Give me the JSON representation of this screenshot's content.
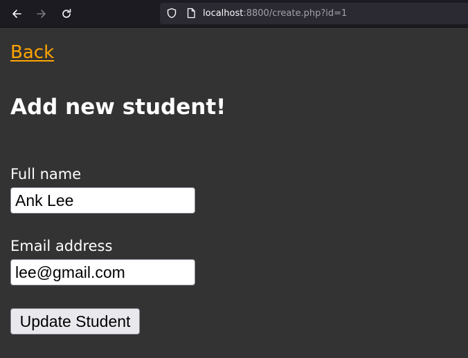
{
  "browser": {
    "url_host": "localhost",
    "url_rest": ":8800/create.php?id=1",
    "icons": {
      "back": "arrow-left-icon",
      "forward": "arrow-right-icon",
      "reload": "reload-icon",
      "tracking": "shield-icon",
      "page": "page-icon"
    }
  },
  "page": {
    "back_link": "Back",
    "title": "Add new student!",
    "form": {
      "full_name_label": "Full name",
      "full_name_value": "Ank Lee",
      "email_label": "Email address",
      "email_value": "lee@gmail.com",
      "submit_label": "Update Student"
    }
  },
  "colors": {
    "page_background": "#333333",
    "link": "#ffa500",
    "text": "#ffffff",
    "toolbar": "#1c1b22",
    "url_bar": "#2b2a33"
  }
}
